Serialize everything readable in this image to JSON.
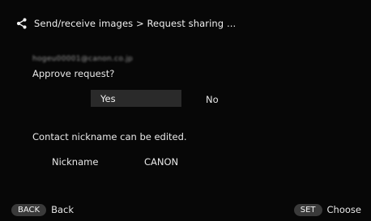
{
  "header": {
    "share_icon": "share-icon",
    "breadcrumb": "Send/receive images > Request sharing ..."
  },
  "request": {
    "email": "hogeu00001@canon.co.jp",
    "question": "Approve request?",
    "yes_label": "Yes",
    "no_label": "No"
  },
  "contact": {
    "note": "Contact nickname can be edited.",
    "nickname_label": "Nickname",
    "nickname_value": "CANON"
  },
  "footer": {
    "back_key": "BACK",
    "back_label": "Back",
    "set_key": "SET",
    "set_label": "Choose"
  }
}
